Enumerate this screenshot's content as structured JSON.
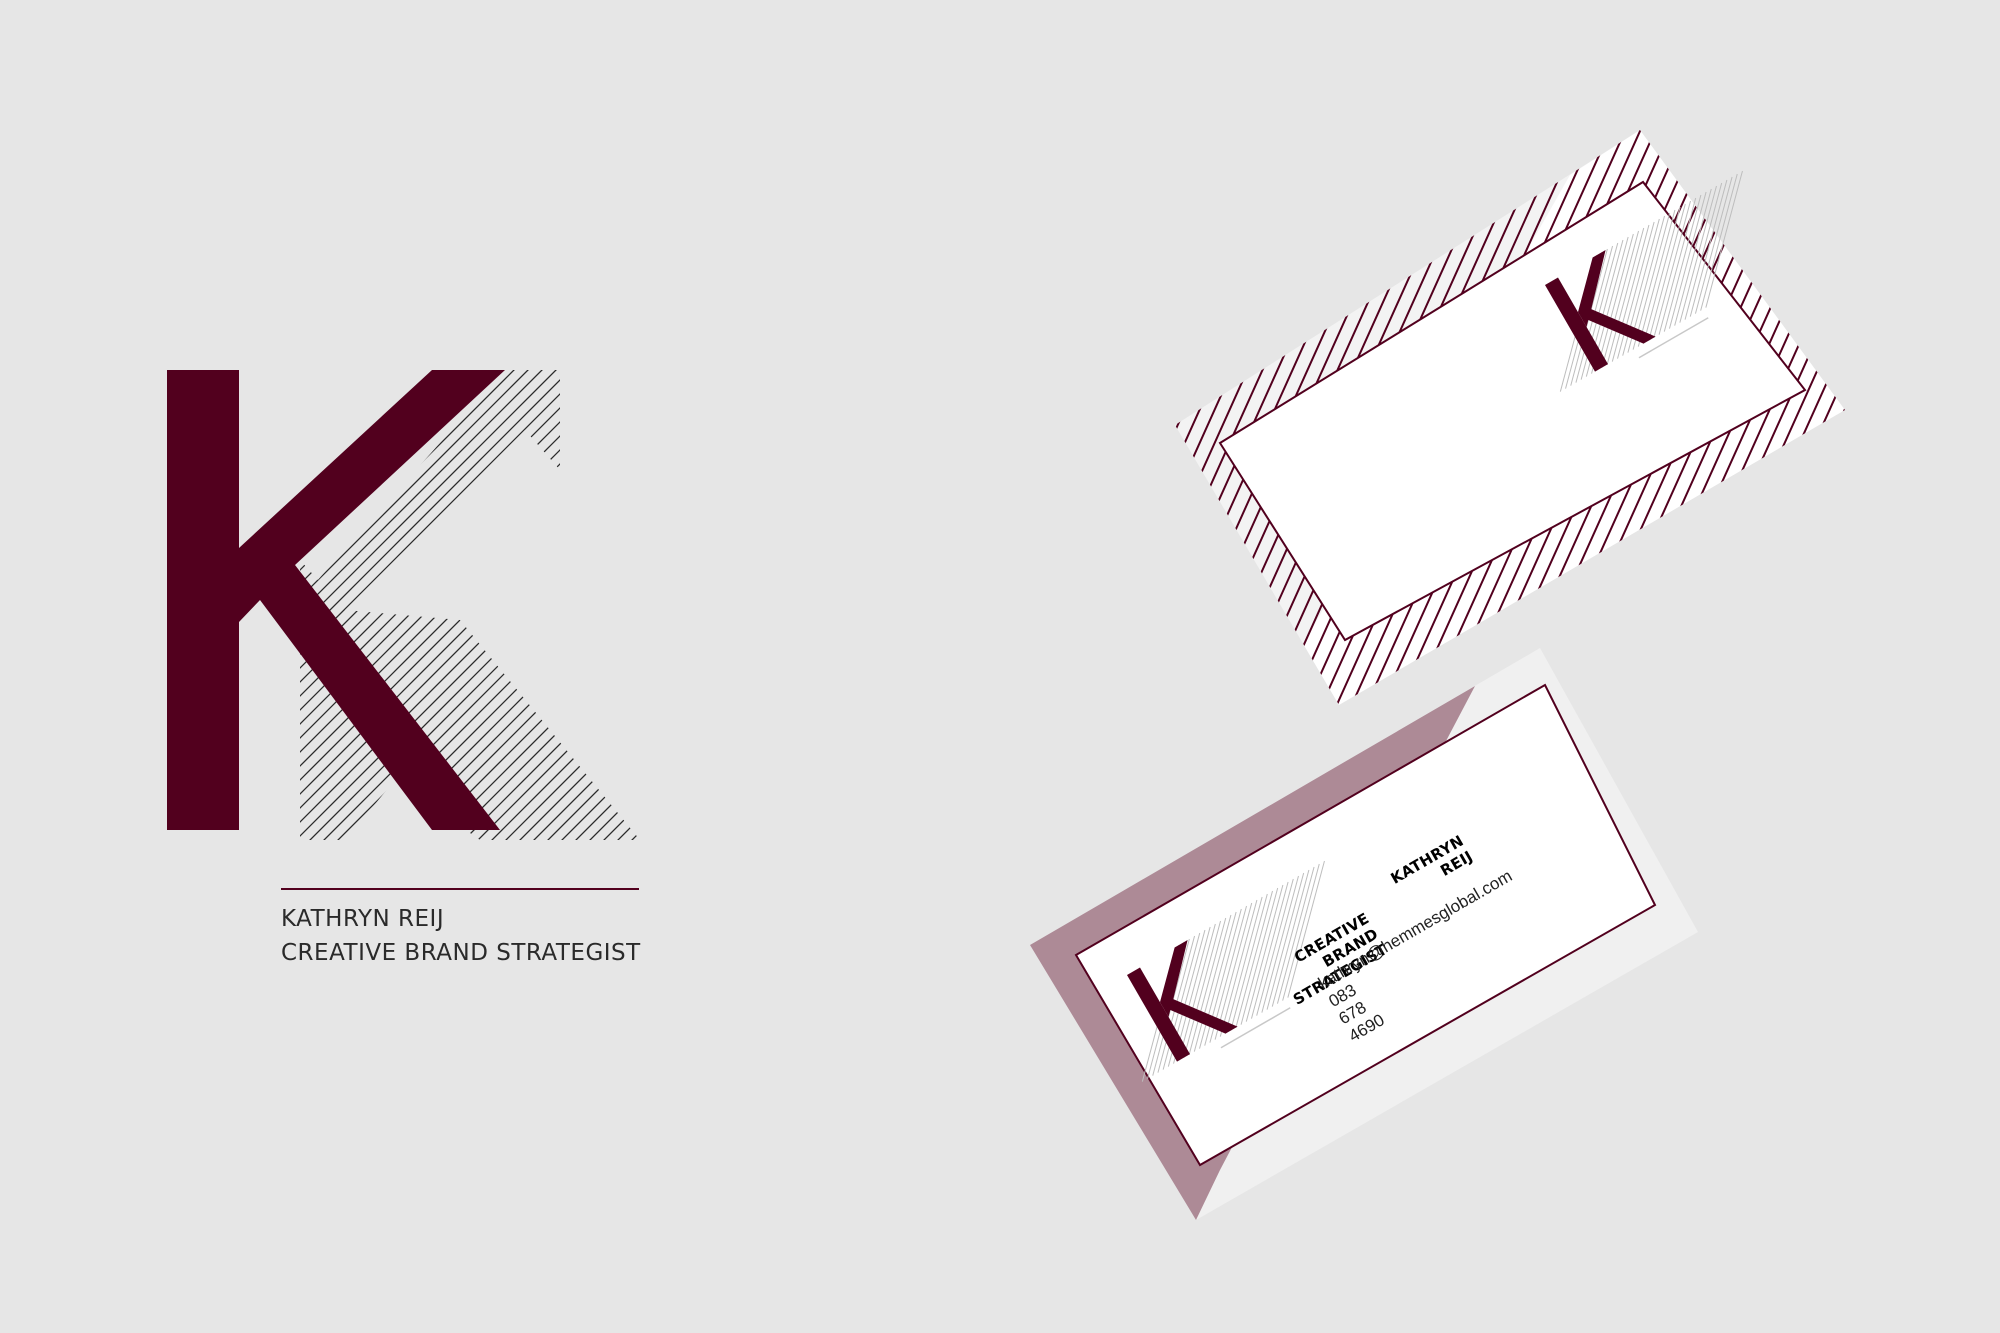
{
  "brand": {
    "monogram": "K",
    "name": "KATHRYN REIJ",
    "title": "CREATIVE BRAND STRATEGIST",
    "colors": {
      "primary": "#52001e",
      "accent_mauve": "#ad8a96",
      "background": "#e6e6e6",
      "card": "#ffffff",
      "card_edge": "#f3f3f3"
    }
  },
  "card_front": {
    "name": "KATHRYN REIJ",
    "title": "CREATIVE BRAND STRATEGIST",
    "email": "kathryn@hemmesglobal.com",
    "phone": "083 678 4690"
  }
}
